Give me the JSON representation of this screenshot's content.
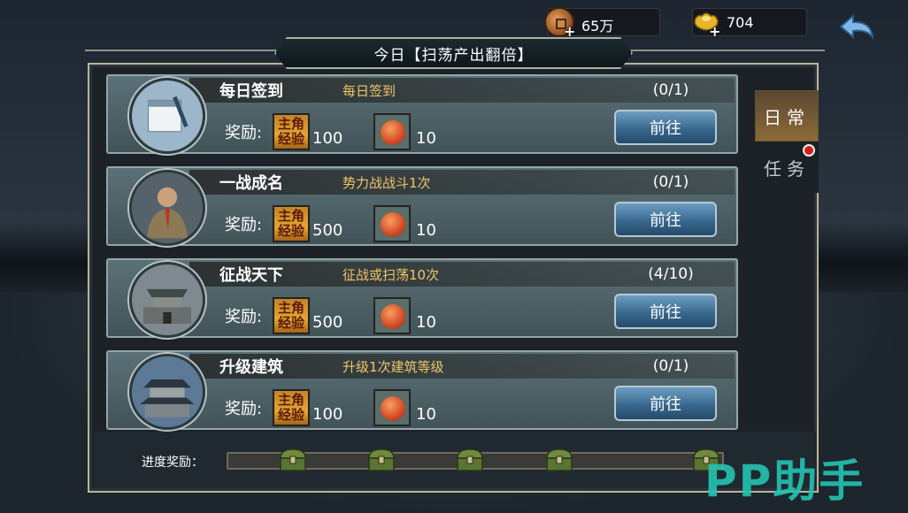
{
  "resources": {
    "copper": "65万",
    "gold": "704",
    "plus": "+"
  },
  "title": "今日【扫荡产出翻倍】",
  "tabs": [
    {
      "label": "日常"
    },
    {
      "label": "任务"
    }
  ],
  "reward_label": "奖励:",
  "exp_icon": {
    "line1": "主角",
    "line2": "经验"
  },
  "go_label": "前往",
  "tasks": [
    {
      "name": "每日签到",
      "desc": "每日签到",
      "progress": "(0/1)",
      "exp": "100",
      "item": "10"
    },
    {
      "name": "一战成名",
      "desc": "势力战战斗1次",
      "progress": "(0/1)",
      "exp": "500",
      "item": "10"
    },
    {
      "name": "征战天下",
      "desc": "征战或扫荡10次",
      "progress": "(4/10)",
      "exp": "500",
      "item": "10"
    },
    {
      "name": "升级建筑",
      "desc": "升级1次建筑等级",
      "progress": "(0/1)",
      "exp": "100",
      "item": "10"
    }
  ],
  "progress_reward": {
    "label": "进度奖励：",
    "fill_fraction": 0.0,
    "chest_count": 5
  },
  "watermark": "PP助手",
  "colors": {
    "accent_gold": "#f0c66a",
    "button_blue": "#35648a",
    "watermark_teal": "#23c4b1",
    "alert_red": "#d61d1d"
  }
}
